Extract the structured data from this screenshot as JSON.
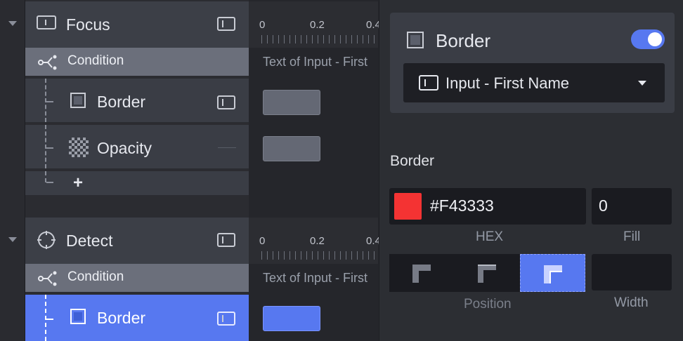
{
  "groups": [
    {
      "title": "Focus",
      "condition_label": "Condition",
      "condition_text": "Text of Input - First",
      "ticks": [
        "0",
        "0.2",
        "0.4"
      ],
      "items": [
        {
          "label": "Border"
        },
        {
          "label": "Opacity"
        }
      ],
      "add_label": "+"
    },
    {
      "title": "Detect",
      "condition_label": "Condition",
      "condition_text": "Text of Input - First",
      "ticks": [
        "0",
        "0.2",
        "0.4"
      ],
      "items": [
        {
          "label": "Border"
        }
      ]
    }
  ],
  "panel": {
    "title": "Border",
    "enabled": true,
    "target": "Input - First Name",
    "section_label": "Border",
    "hex_value": "#F43333",
    "hex_label": "HEX",
    "fill_value": "0",
    "fill_label": "Fill",
    "position_label": "Position",
    "width_label": "Width",
    "width_value": "",
    "position_selected": 2
  },
  "colors": {
    "accent": "#5778f0",
    "swatch": "#F43333"
  }
}
